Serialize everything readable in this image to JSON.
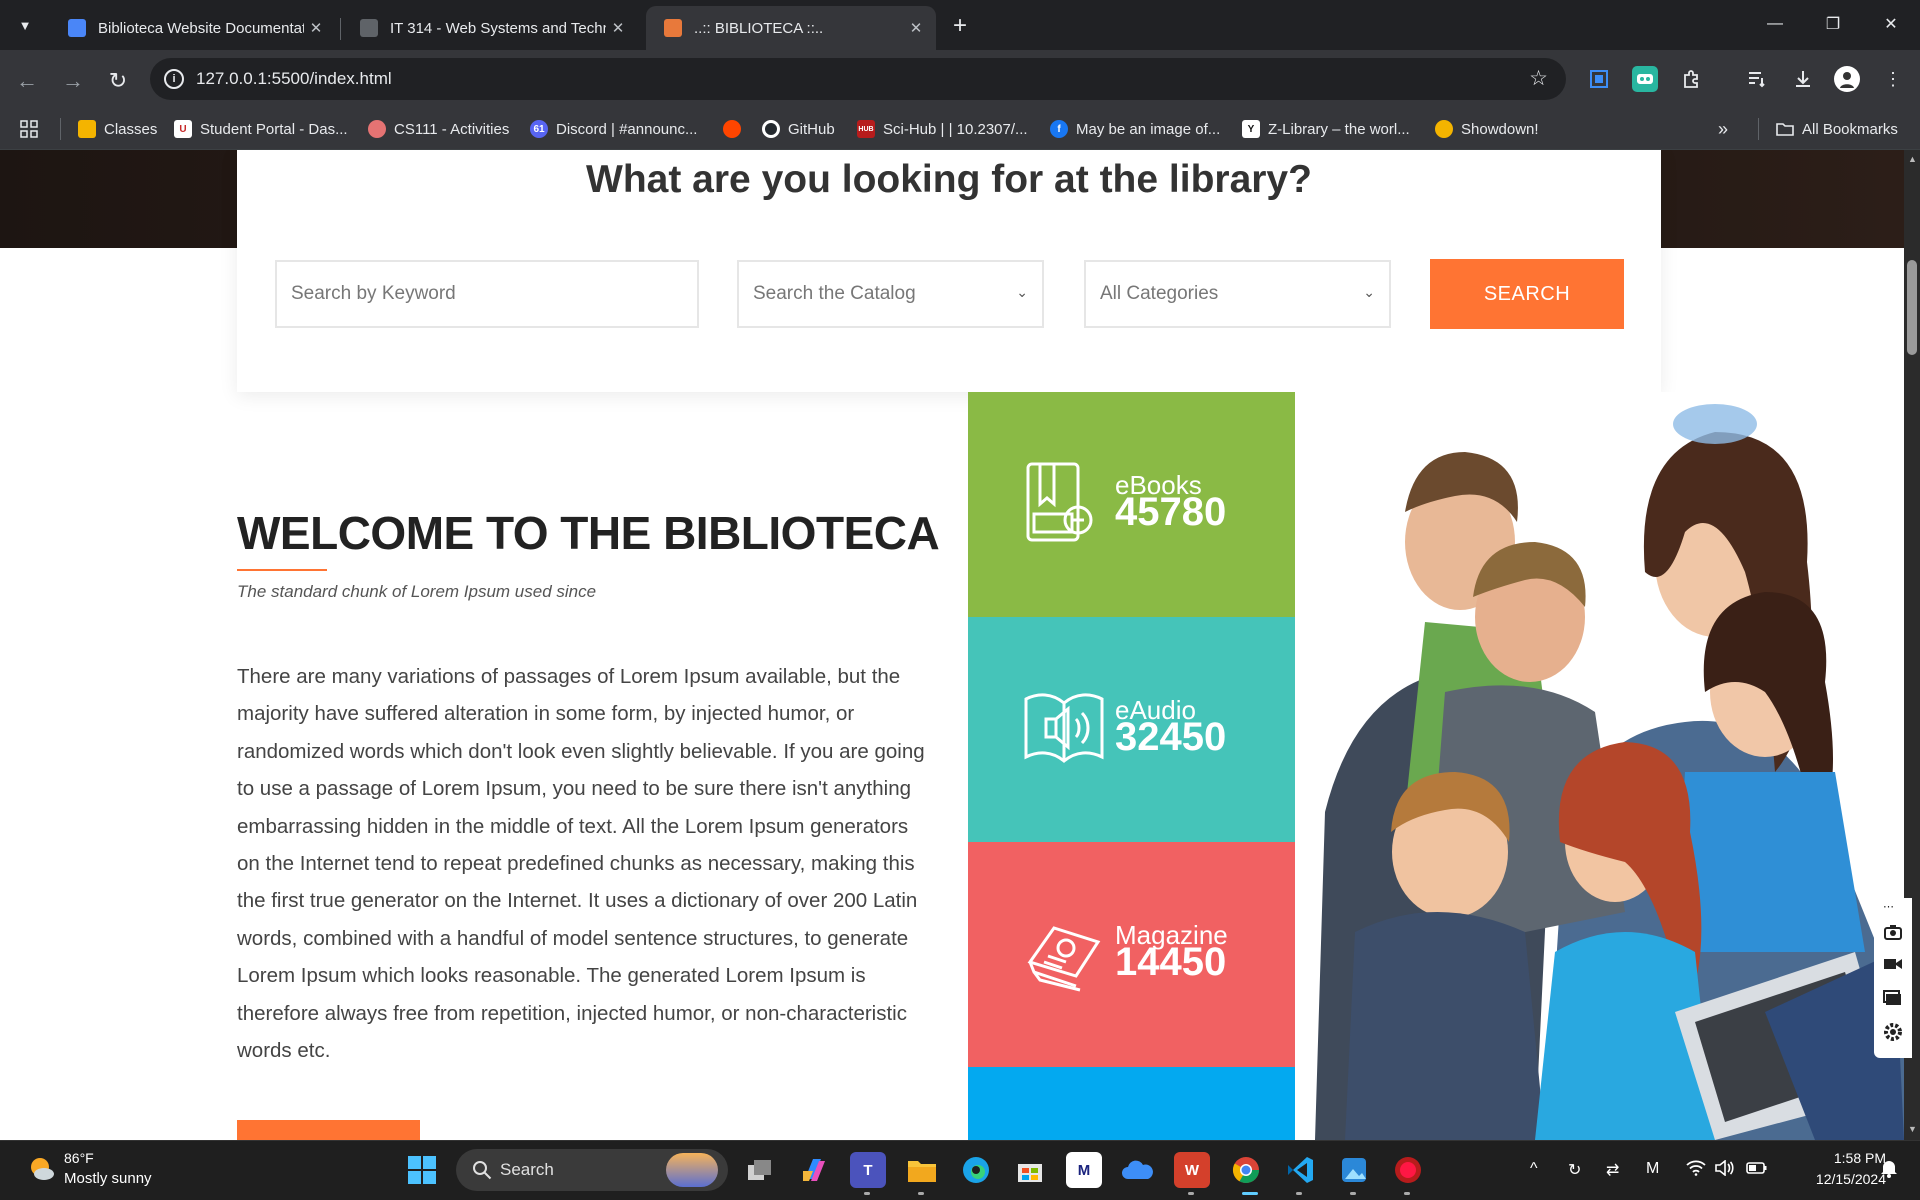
{
  "browser": {
    "tabs": [
      {
        "title": "Biblioteca Website Documentati",
        "favicon": "docs-icon",
        "color": "#4a86f7"
      },
      {
        "title": "IT 314 - Web Systems and Techn",
        "favicon": "classroom-icon",
        "color": "#5f6368"
      },
      {
        "title": "..:: BIBLIOTECA ::..",
        "favicon": "book-icon",
        "color": "#e8793b"
      }
    ],
    "url": "127.0.0.1:5500/index.html",
    "bookmarks": [
      {
        "label": "Classes",
        "color": "#f4b400"
      },
      {
        "label": "Student Portal - Das...",
        "color": "#c62828"
      },
      {
        "label": "CS111 - Activities",
        "color": "#e57373"
      },
      {
        "label": "Discord | #announc...",
        "color": "#5865f2",
        "badge": "61"
      },
      {
        "label": "",
        "color": "#ff4500"
      },
      {
        "label": "GitHub",
        "color": "#ffffff"
      },
      {
        "label": "Sci-Hub | | 10.2307/...",
        "color": "#b71c1c"
      },
      {
        "label": "May be an image of...",
        "color": "#1877f2"
      },
      {
        "label": "Z-Library – the worl...",
        "color": "#ffffff"
      },
      {
        "label": "Showdown!",
        "color": "#f4b400"
      }
    ],
    "all_bookmarks": "All Bookmarks"
  },
  "page": {
    "search_title": "What are you looking for at the library?",
    "keyword_placeholder": "Search by Keyword",
    "catalog_select": "Search the Catalog",
    "category_select": "All Categories",
    "search_button": "SEARCH",
    "welcome_title": "WELCOME TO THE BIBLIOTECA",
    "welcome_subtitle": "The standard chunk of Lorem Ipsum used since",
    "welcome_text": "There are many variations of passages of Lorem Ipsum available, but the majority have suffered alteration in some form, by injected humor, or randomized words which don't look even slightly believable. If you are going to use a passage of Lorem Ipsum, you need to be sure there isn't anything embarrassing hidden in the middle of text. All the Lorem Ipsum generators on the Internet tend to repeat predefined chunks as necessary, making this the first true generator on the Internet. It uses a dictionary of over 200 Latin words, combined with a handful of model sentence structures, to generate Lorem Ipsum which looks reasonable. The generated Lorem Ipsum is therefore always free from repetition, injected humor, or non-characteristic words etc.",
    "stats": [
      {
        "label": "eBooks",
        "value": "45780",
        "color": "#8aba45",
        "icon": "ebook-icon"
      },
      {
        "label": "eAudio",
        "value": "32450",
        "color": "#45c4b9",
        "icon": "audiobook-icon"
      },
      {
        "label": "Magazine",
        "value": "14450",
        "color": "#f16162",
        "icon": "magazine-icon"
      },
      {
        "label": "",
        "value": "",
        "color": "#03a9f0",
        "icon": ""
      }
    ],
    "accent": "#ff7433"
  },
  "taskbar": {
    "temperature": "86°F",
    "weather": "Mostly sunny",
    "search": "Search",
    "time": "1:58 PM",
    "date": "12/15/2024"
  }
}
